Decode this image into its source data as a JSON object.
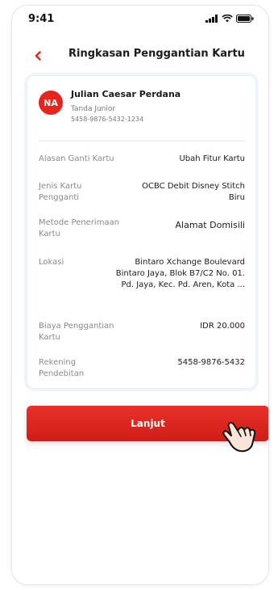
{
  "status_bar": {
    "time": "9:41",
    "icons": [
      "signal-icon",
      "wifi-icon",
      "battery-icon"
    ]
  },
  "header": {
    "title": "Ringkasan Penggantian Kartu",
    "back_icon": "chevron-left-icon"
  },
  "user": {
    "initials": "NA",
    "name": "Julian Caesar Perdana",
    "tier": "Tanda Junior",
    "account_number": "5458-9876-5432-1234"
  },
  "details": [
    {
      "label": "Alasan Ganti Kartu",
      "value": "Ubah Fitur Kartu"
    },
    {
      "label": "Jenis Kartu Pengganti",
      "value": "OCBC Debit Disney Stitch Biru"
    },
    {
      "label": "Metode Penerimaan Kartu",
      "value": "Alamat Domisili"
    },
    {
      "label": "Lokasi",
      "value": "Bintaro Xchange Boulevard Bintaro Jaya, Blok B7/C2 No. 01. Pd. Jaya, Kec. Pd. Aren, Kota ..."
    },
    {
      "label": "Biaya Penggantian Kartu",
      "value": "IDR 20.000"
    },
    {
      "label": "Rekening Pendebitan",
      "value": "5458-9876-5432"
    }
  ],
  "actions": {
    "continue_label": "Lanjut"
  },
  "colors": {
    "brand_red": "#E8241C",
    "button_red": "#D01D17",
    "text_primary": "#1B1B1B",
    "text_secondary": "#8A8A8A",
    "card_border": "#E8F0F8"
  }
}
